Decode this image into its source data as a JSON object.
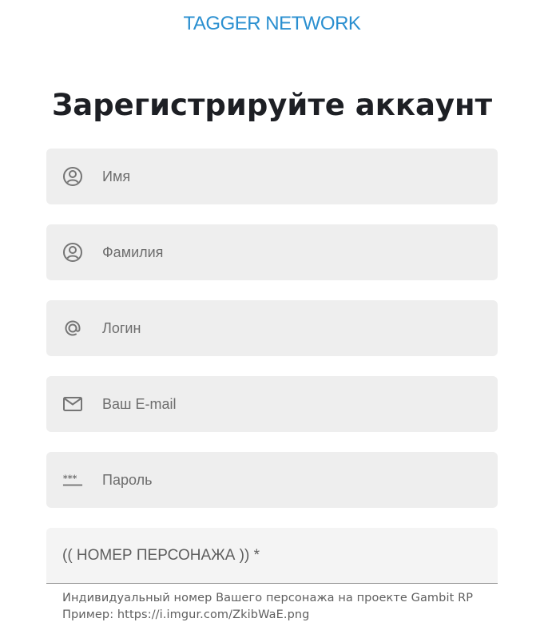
{
  "brand": {
    "name": "TAGGER NETWORK",
    "color": "#2a8fd0"
  },
  "page_title": "Зарегистрируйте аккаунт",
  "fields": {
    "first_name": {
      "placeholder": "Имя",
      "icon": "person-circle-icon"
    },
    "last_name": {
      "placeholder": "Фамилия",
      "icon": "person-circle-icon"
    },
    "login": {
      "placeholder": "Логин",
      "icon": "at-sign-icon"
    },
    "email": {
      "placeholder": "Ваш E-mail",
      "icon": "mail-icon"
    },
    "password": {
      "placeholder": "Пароль",
      "icon": "password-icon"
    },
    "character_number": {
      "label": "(( НОМЕР ПЕРСОНАЖА )) *"
    }
  },
  "helper": {
    "line1": "Индивидуальный номер Вашего персонажа на проекте Gambit RP",
    "line2": "Пример: https://i.imgur.com/ZkibWaE.png"
  },
  "colors": {
    "field_background": "#eeeeee",
    "title": "#1d1f24",
    "icon": "#757575"
  }
}
